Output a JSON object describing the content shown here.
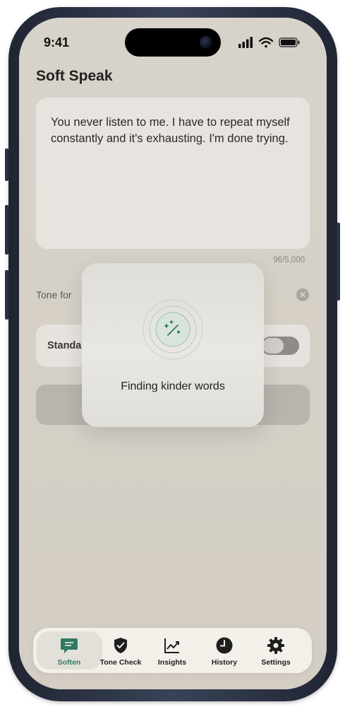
{
  "status_bar": {
    "time": "9:41"
  },
  "app": {
    "title": "Soft Speak"
  },
  "input": {
    "text": "You never listen to me. I have to repeat myself constantly and it's exhausting. I'm done trying.",
    "char_count": "96/5,000"
  },
  "tone": {
    "label": "Tone for"
  },
  "mode": {
    "label": "Standa",
    "toggle_on": false
  },
  "loading": {
    "message": "Finding kinder words",
    "icon": "magic-wand-icon"
  },
  "tab_bar": {
    "tabs": [
      {
        "label": "Soften",
        "icon": "chat-icon",
        "active": true
      },
      {
        "label": "Tone Check",
        "icon": "shield-check-icon",
        "active": false
      },
      {
        "label": "Insights",
        "icon": "chart-icon",
        "active": false
      },
      {
        "label": "History",
        "icon": "clock-icon",
        "active": false
      },
      {
        "label": "Settings",
        "icon": "gear-icon",
        "active": false
      }
    ]
  },
  "colors": {
    "accent": "#2f7a63",
    "background": "#dcd7cf"
  }
}
